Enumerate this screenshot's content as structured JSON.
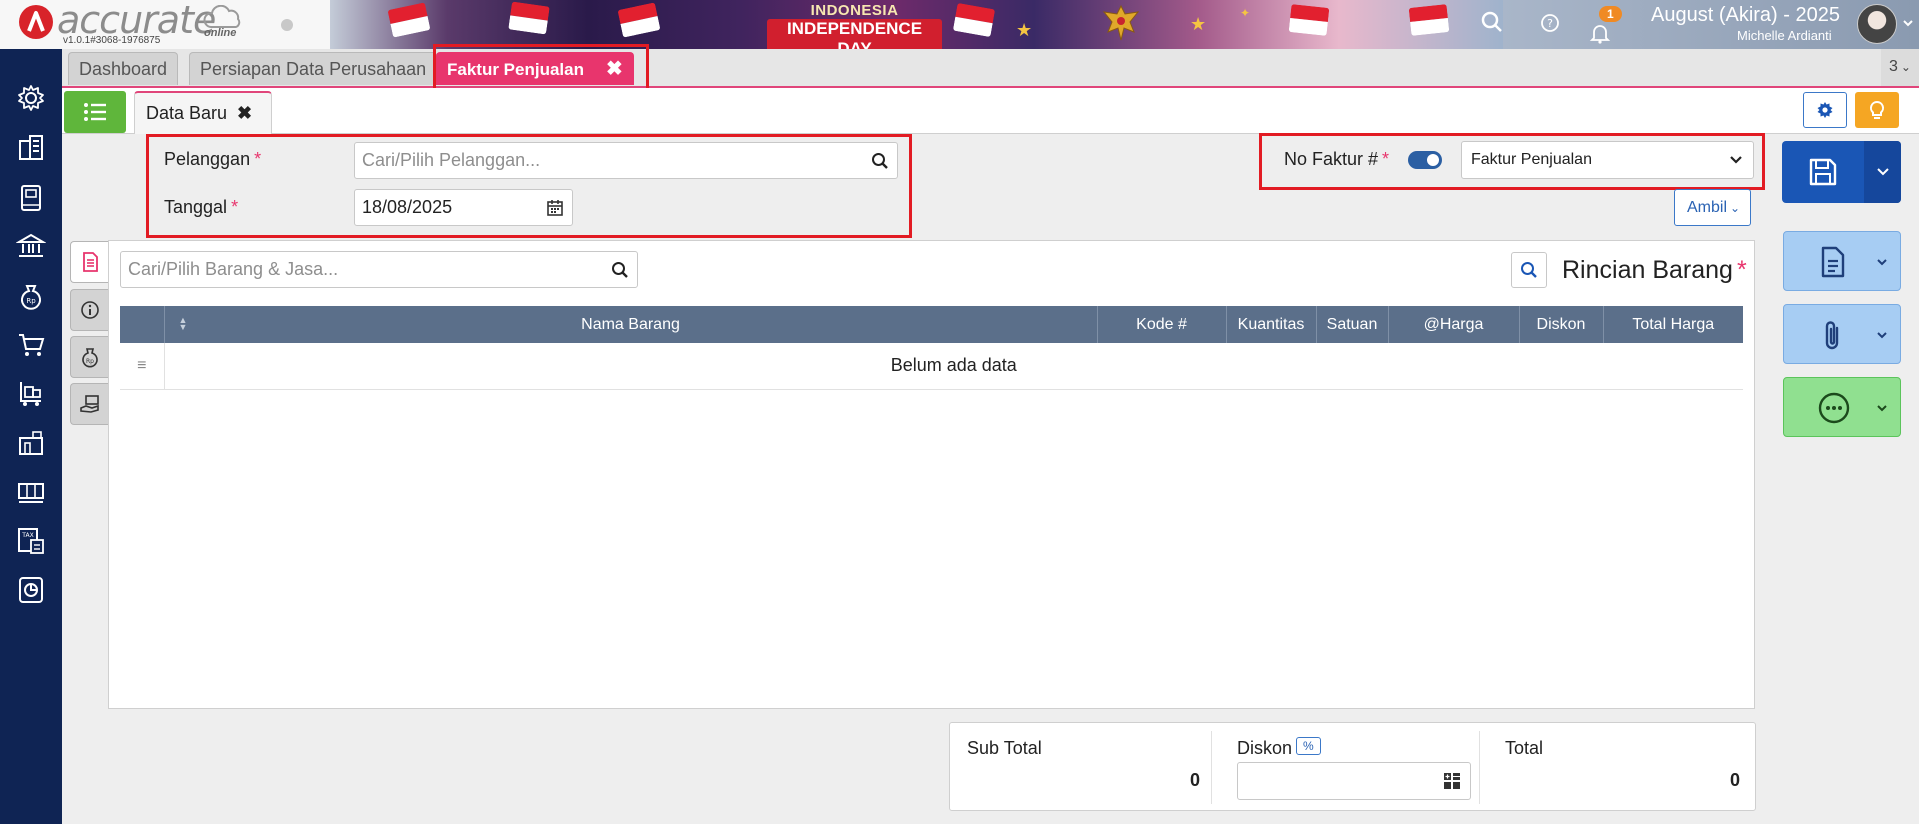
{
  "header": {
    "logo_text": "accurate",
    "logo_sub": "online",
    "version": "v1.0.1#3068-1976875",
    "banner_line1": "INDONESIA",
    "banner_line2": "INDEPENDENCE DAY",
    "notification_count": "1",
    "company": "August (Akira) - 2025",
    "user_name": "Michelle Ardianti"
  },
  "sidebar": {
    "icons": [
      "settings-icon",
      "company-icon",
      "ledger-book-icon",
      "bank-icon",
      "cash-bag-icon",
      "shopping-cart-icon",
      "purchase-trolley-icon",
      "warehouse-icon",
      "inventory-icon",
      "tax-icon",
      "report-icon"
    ]
  },
  "tabs": {
    "items": [
      "Dashboard",
      "Persiapan Data Perusahaan",
      "Faktur Penjualan"
    ],
    "active": "Faktur Penjualan",
    "close_symbol": "✖",
    "overflow_count": "3"
  },
  "subtabs": {
    "label": "Data Baru",
    "close_symbol": "✖"
  },
  "form": {
    "pelanggan_label": "Pelanggan",
    "pelanggan_placeholder": "Cari/Pilih Pelanggan...",
    "tanggal_label": "Tanggal",
    "tanggal_value": "18/08/2025",
    "required_mark": "*",
    "nofaktur_label": "No Faktur #",
    "nofaktur_toggle_on": true,
    "nofaktur_select": "Faktur Penjualan",
    "ambil_label": "Ambil"
  },
  "items": {
    "search_placeholder": "Cari/Pilih Barang & Jasa...",
    "title": "Rincian Barang",
    "columns": [
      "Nama Barang",
      "Kode #",
      "Kuantitas",
      "Satuan",
      "@Harga",
      "Diskon",
      "Total Harga"
    ],
    "empty_text": "Belum ada data"
  },
  "totals": {
    "subtotal_label": "Sub Total",
    "subtotal_value": "0",
    "diskon_label": "Diskon",
    "diskon_badge": "%",
    "diskon_value": "",
    "total_label": "Total",
    "total_value": "0"
  },
  "colors": {
    "accent_pink": "#e8356d",
    "sidebar_navy": "#0f2454",
    "save_blue": "#1a56b5",
    "highlight_red": "#e21b23"
  }
}
